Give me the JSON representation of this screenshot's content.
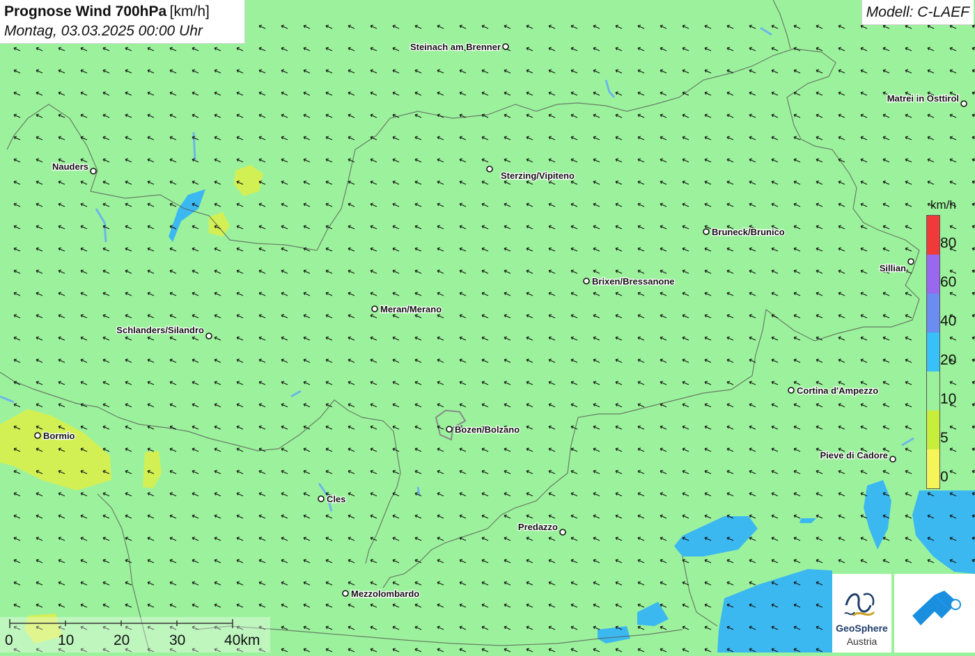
{
  "header": {
    "title_bold": "Prognose Wind 700hPa",
    "title_unit": "[km/h]",
    "datetime": "Montag, 03.03.2025 00:00 Uhr",
    "model": "Modell: C-LAEF"
  },
  "places": [
    {
      "name": "Steinach am Brenner"
    },
    {
      "name": "Matrei in Osttirol"
    },
    {
      "name": "Nauders"
    },
    {
      "name": "Sterzing/Vipiteno"
    },
    {
      "name": "Bruneck/Brunico"
    },
    {
      "name": "Sillian"
    },
    {
      "name": "Brixen/Bressanone"
    },
    {
      "name": "Meran/Merano"
    },
    {
      "name": "Schlanders/Silandro"
    },
    {
      "name": "Cortina d'Ampezzo"
    },
    {
      "name": "Bormio"
    },
    {
      "name": "Bozen/Bolzano"
    },
    {
      "name": "Pieve di Cadore"
    },
    {
      "name": "Cles"
    },
    {
      "name": "Predazzo"
    },
    {
      "name": "Mezzolombardo"
    }
  ],
  "legend": {
    "unit": "km/h",
    "labels": [
      "80",
      "60",
      "40",
      "20",
      "10",
      "5",
      "0"
    ],
    "colors": [
      "#f03a3a",
      "#9a68ee",
      "#6b8cf0",
      "#38c0f8",
      "#9cf29c",
      "#c8ee3c",
      "#f5f55a"
    ]
  },
  "scalebar": {
    "labels": [
      "0",
      "10",
      "20",
      "30",
      "40km"
    ]
  },
  "logos": {
    "geosphere_line1": "GeoSphere",
    "geosphere_line2": "Austria"
  },
  "wind": {
    "direction": "from south-east",
    "predominant_speed_class": "10"
  },
  "colors": {
    "field": "#9cf29c",
    "low": "#e0f05a",
    "high": "#3cb8f0",
    "borders": "#555555"
  }
}
